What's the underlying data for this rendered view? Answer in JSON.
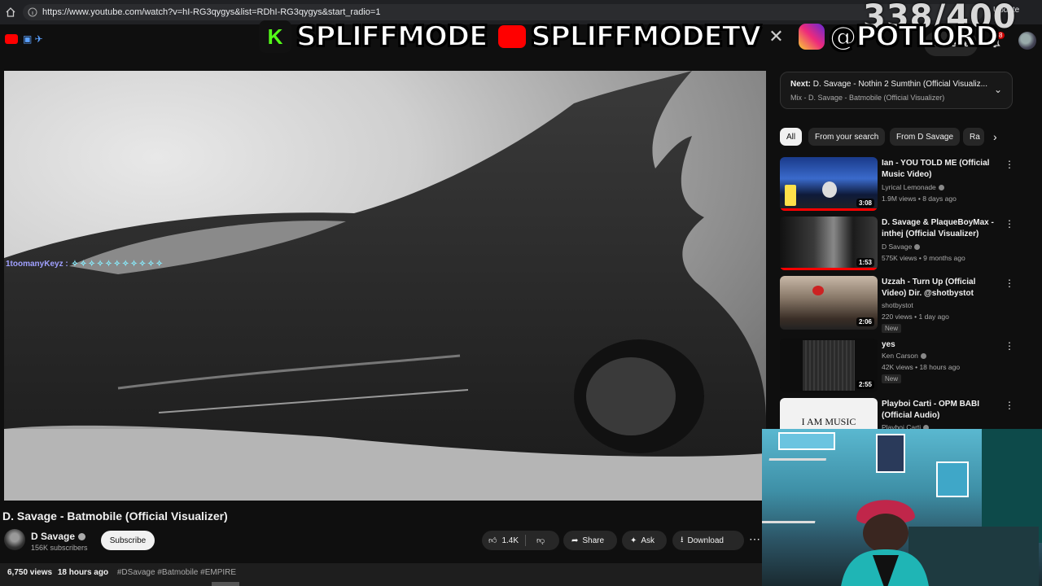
{
  "browser": {
    "url": "https://www.youtube.com/watch?v=hI-RG3qygys&list=RDhI-RG3qygys&start_radio=1",
    "update_label": "Update"
  },
  "overlay": {
    "counter": "338/400",
    "handles": [
      "SPLIFFMODE",
      "SPLIFFMODETV",
      "@POTLORD"
    ],
    "kick_letter": "K"
  },
  "header": {
    "create_label": "Create",
    "notification_count": "8"
  },
  "video": {
    "chat_user": "1toomanyKeyz :",
    "chat_emotes": "✧✧✧✧✧✧✧✧✧✧✧",
    "title": "D. Savage - Batmobile (Official Visualizer)",
    "channel": "D Savage",
    "subscribers": "156K subscribers",
    "subscribe_label": "Subscribe",
    "likes": "1.4K",
    "share_label": "Share",
    "ask_label": "Ask",
    "download_label": "Download",
    "views": "6,750 views",
    "age": "18 hours ago",
    "tags": "#DSavage #Batmobile #EMPIRE"
  },
  "up_next": {
    "prefix": "Next:",
    "title": "D. Savage - Nothin 2 Sumthin (Official Visualiz...",
    "mix": "Mix - D. Savage - Batmobile (Official Visualizer)"
  },
  "chips": [
    "All",
    "From your search",
    "From D Savage",
    "Ra"
  ],
  "recommendations": [
    {
      "title": "Ian - YOU TOLD ME (Official Music Video)",
      "channel": "Lyrical Lemonade",
      "meta": "1.9M views • 8 days ago",
      "duration": "3:08",
      "progress": 1.0,
      "badge": ""
    },
    {
      "title": "D. Savage & PlaqueBoyMax - inthej (Official Visualizer)",
      "channel": "D Savage",
      "meta": "575K views • 9 months ago",
      "duration": "1:53",
      "progress": 1.0,
      "badge": ""
    },
    {
      "title": "Uzzah - Turn Up (Official Video) Dir. @shotbystot",
      "channel": "shotbystot",
      "meta": "220 views • 1 day ago",
      "duration": "2:06",
      "progress": 0,
      "badge": "New"
    },
    {
      "title": "yes",
      "channel": "Ken Carson",
      "meta": "42K views • 18 hours ago",
      "duration": "2:55",
      "progress": 0,
      "badge": "New"
    },
    {
      "title": "Playboi Carti - OPM BABI (Official Audio)",
      "channel": "Playboi Carti",
      "meta": "",
      "duration": "",
      "progress": 0,
      "badge": "",
      "thumb_text": "I AM MUSIC"
    }
  ]
}
